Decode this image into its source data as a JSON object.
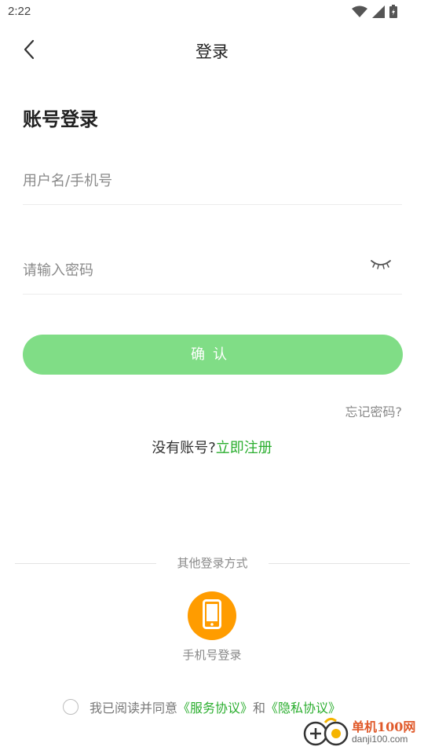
{
  "status_bar": {
    "time": "2:22",
    "icons": [
      "wifi-icon",
      "cellular-signal-icon",
      "battery-icon"
    ]
  },
  "nav": {
    "back_icon": "chevron-left-icon",
    "title": "登录"
  },
  "login": {
    "section_title": "账号登录",
    "username_placeholder": "用户名/手机号",
    "password_placeholder": "请输入密码",
    "password_toggle_icon": "eye-closed-icon",
    "confirm_label": "确认",
    "forgot_password": "忘记密码?",
    "no_account_text": "没有账号?",
    "register_link": "立即注册"
  },
  "other_login": {
    "divider_text": "其他登录方式",
    "phone_login_icon": "mobile-phone-icon",
    "phone_login_label": "手机号登录"
  },
  "agreement": {
    "prefix": "我已阅读并同意",
    "service_link": "《服务协议》",
    "conjunction": "和",
    "privacy_link": "《隐私协议》",
    "checked": false
  },
  "watermark": {
    "title": "单机100网",
    "url": "danji100.com"
  },
  "colors": {
    "accent_green": "#2bae2f",
    "button_green": "#80dd86",
    "phone_orange": "#ff9c00"
  }
}
